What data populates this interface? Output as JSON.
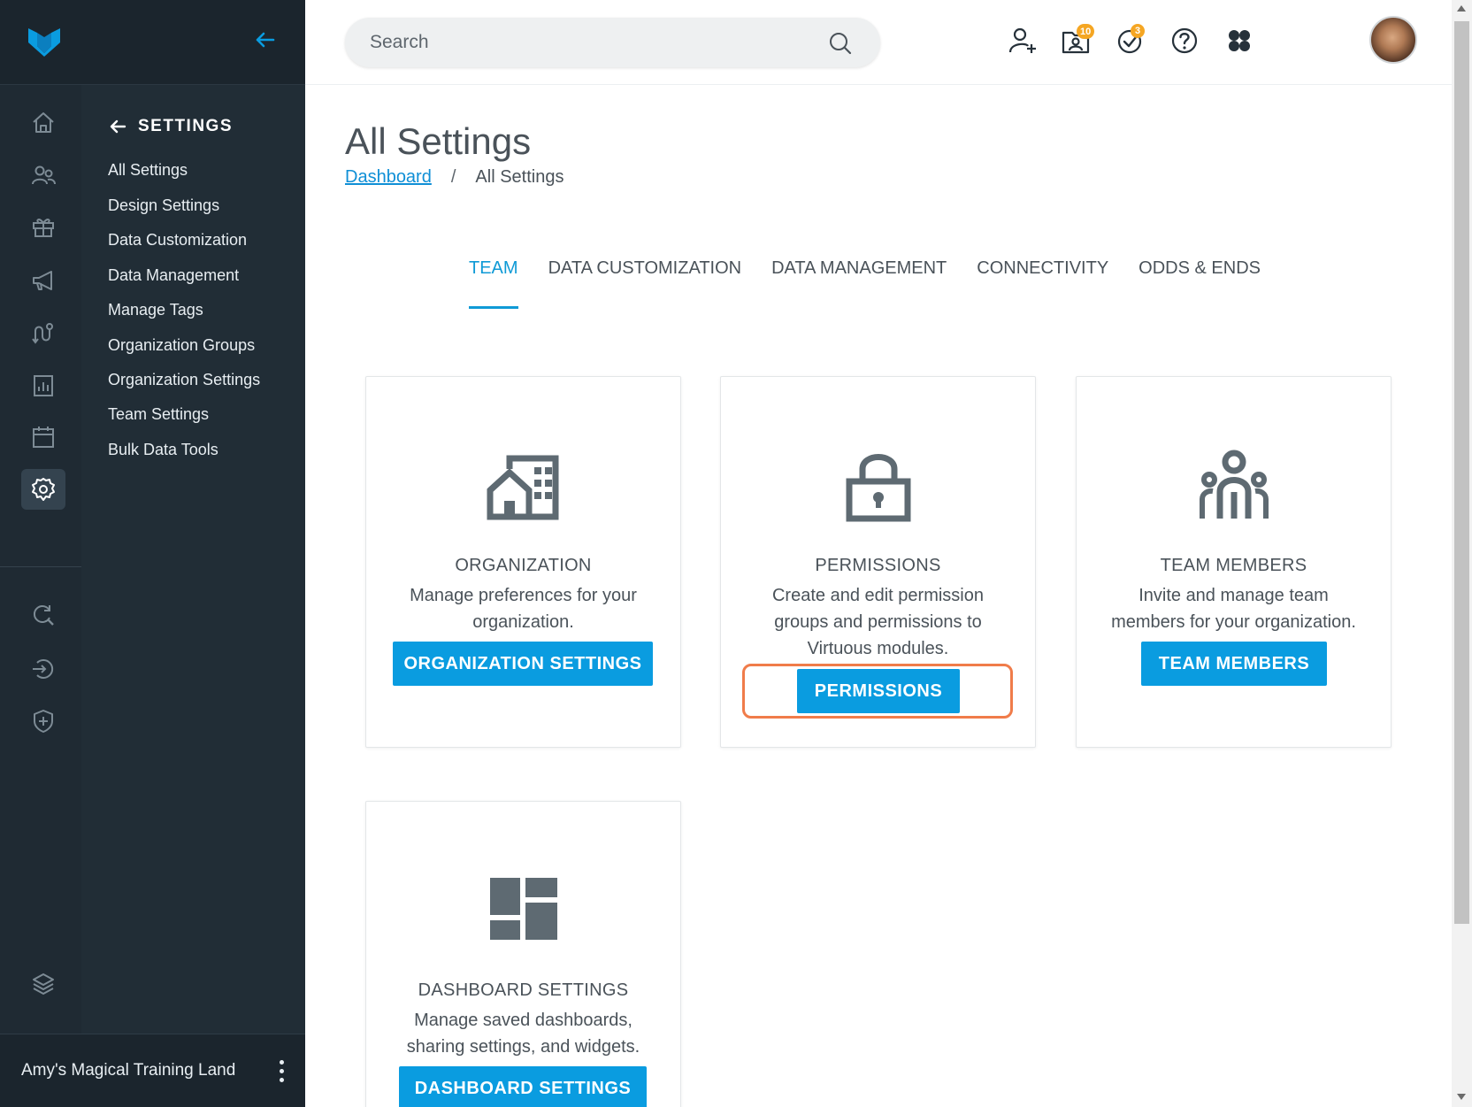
{
  "sidebar": {
    "collapse_label": "",
    "settings_header": "SETTINGS",
    "items": [
      {
        "label": "All Settings"
      },
      {
        "label": "Design Settings"
      },
      {
        "label": "Data Customization"
      },
      {
        "label": "Data Management"
      },
      {
        "label": "Manage Tags"
      },
      {
        "label": "Organization Groups"
      },
      {
        "label": "Organization Settings"
      },
      {
        "label": "Team Settings"
      },
      {
        "label": "Bulk Data Tools"
      }
    ],
    "rail_icons": [
      "home-icon",
      "people-icon",
      "gift-icon",
      "megaphone-icon",
      "workflow-icon",
      "report-icon",
      "calendar-icon",
      "settings-gear-icon",
      "query-icon",
      "import-icon",
      "security-shield-icon",
      "layers-icon"
    ],
    "active_rail_icon": "settings-gear-icon",
    "org_name": "Amy's Magical Training Land"
  },
  "topbar": {
    "search_placeholder": "Search",
    "icons": [
      "add-user-icon",
      "inbox-contact-icon",
      "tasks-check-icon",
      "help-icon",
      "apps-grid-icon"
    ],
    "inbox_badge": "10",
    "tasks_badge": "3",
    "avatar": "user-avatar"
  },
  "page": {
    "title": "All Settings",
    "breadcrumb": {
      "link": "Dashboard",
      "separator": "/",
      "current": "All Settings"
    },
    "tabs": [
      {
        "label": "TEAM",
        "active": true
      },
      {
        "label": "DATA CUSTOMIZATION",
        "active": false
      },
      {
        "label": "DATA MANAGEMENT",
        "active": false
      },
      {
        "label": "CONNECTIVITY",
        "active": false
      },
      {
        "label": "ODDS & ENDS",
        "active": false
      }
    ],
    "cards": [
      {
        "icon": "building-icon",
        "title": "ORGANIZATION",
        "description": "Manage preferences for your organization.",
        "button": "ORGANIZATION SETTINGS"
      },
      {
        "icon": "lock-icon",
        "title": "PERMISSIONS",
        "description": "Create and edit permission groups and permissions to Virtuous modules.",
        "button": "PERMISSIONS",
        "highlighted": true
      },
      {
        "icon": "team-icon",
        "title": "TEAM MEMBERS",
        "description": "Invite and manage team members for your organization.",
        "button": "TEAM MEMBERS"
      },
      {
        "icon": "dashboard-layout-icon",
        "title": "DASHBOARD SETTINGS",
        "description": "Manage saved dashboards, sharing settings, and widgets.",
        "button": "DASHBOARD SETTINGS"
      }
    ]
  },
  "colors": {
    "rail_bg": "#1f2a33",
    "subnav_bg": "#212d36",
    "accent_blue": "#0a9ce0",
    "tab_active": "#0f9ad6",
    "badge": "#f5a623",
    "highlight": "#f07c4a",
    "icon_gray": "#5e6a72"
  }
}
